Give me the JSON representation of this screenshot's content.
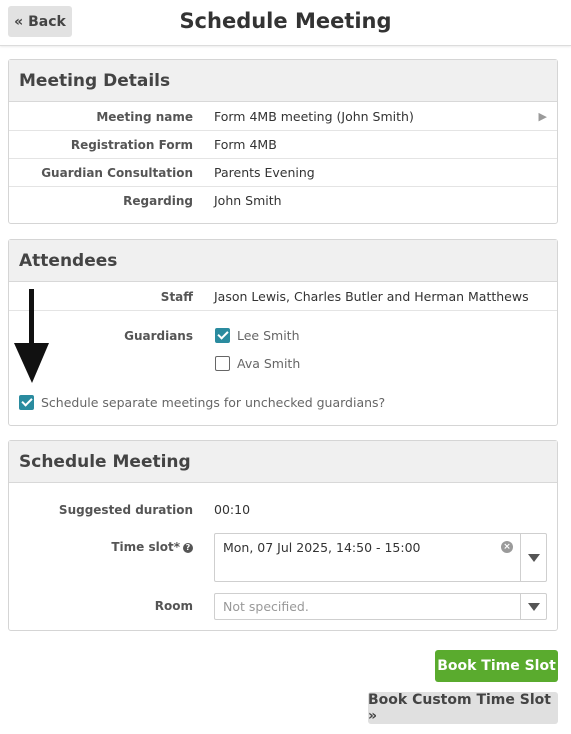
{
  "header": {
    "back_label": "« Back",
    "title": "Schedule Meeting"
  },
  "meeting_details": {
    "heading": "Meeting Details",
    "rows": [
      {
        "label": "Meeting name",
        "value": "Form 4MB meeting (John Smith)"
      },
      {
        "label": "Registration Form",
        "value": "Form 4MB"
      },
      {
        "label": "Guardian Consultation",
        "value": "Parents Evening"
      },
      {
        "label": "Regarding",
        "value": "John Smith"
      }
    ],
    "expand_icon": "triangle-right-icon"
  },
  "attendees": {
    "heading": "Attendees",
    "staff_label": "Staff",
    "staff_value": "Jason Lewis, Charles Butler and Herman Matthews",
    "guardians_label": "Guardians",
    "guardians": [
      {
        "name": "Lee Smith",
        "checked": true
      },
      {
        "name": "Ava Smith",
        "checked": false
      }
    ],
    "separate_meetings_label": "Schedule separate meetings for unchecked guardians?",
    "separate_meetings_checked": true
  },
  "schedule": {
    "heading": "Schedule Meeting",
    "duration_label": "Suggested duration",
    "duration_value": "00:10",
    "time_slot_label": "Time slot*",
    "time_slot_value": "Mon, 07 Jul 2025, 14:50 - 15:00",
    "room_label": "Room",
    "room_placeholder": "Not specified."
  },
  "actions": {
    "book_label": "Book Time Slot",
    "custom_label": "Book Custom Time Slot »"
  },
  "colors": {
    "accent": "#2a8b9f",
    "primary_button": "#5aab2e"
  }
}
